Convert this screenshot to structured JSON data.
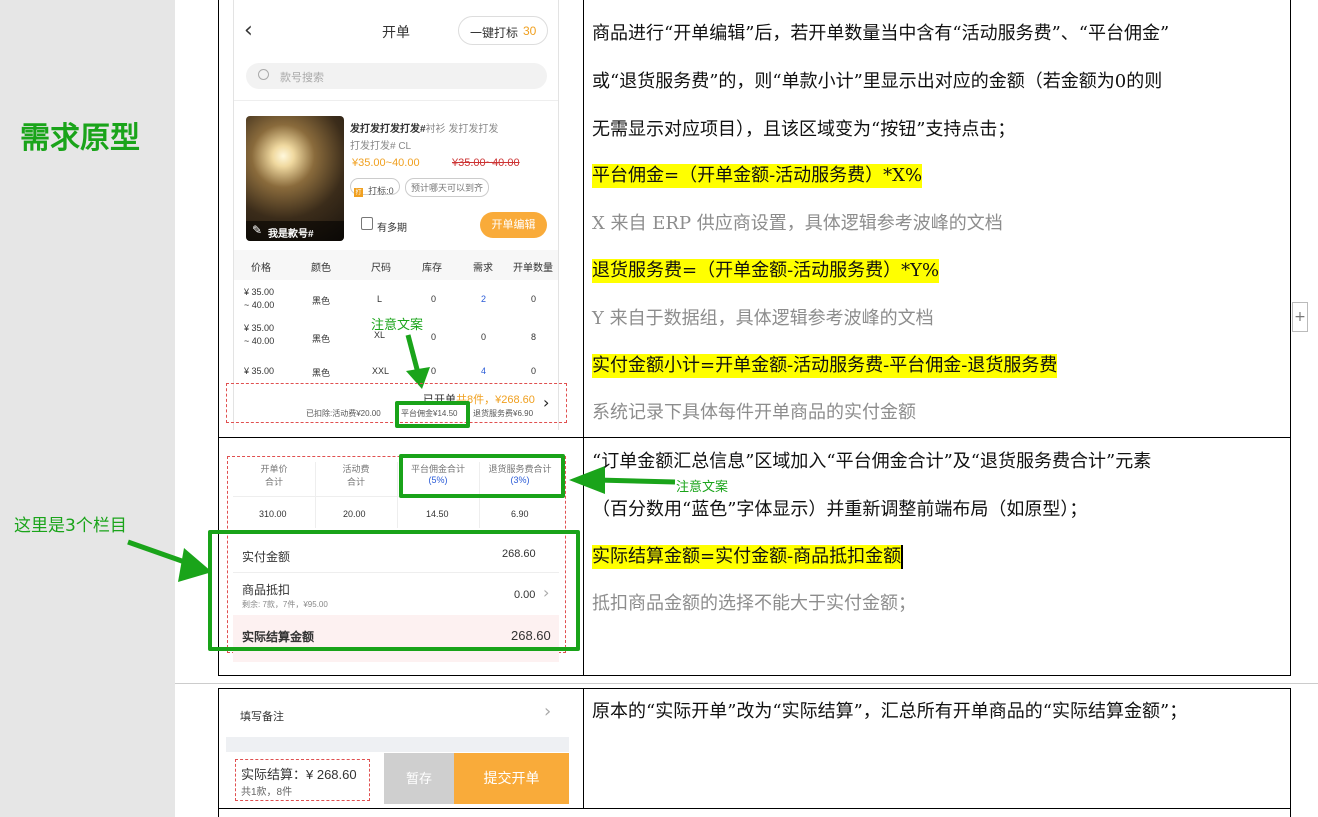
{
  "side_labels": {
    "prototype_heading": "需求原型",
    "three_columns_note": "这里是3个栏目"
  },
  "mock_top": {
    "nav_title": "开单",
    "quick_mark_label": "一键打标",
    "quick_mark_count": "30",
    "search_placeholder": "款号搜索",
    "product_title": "发打发打发打发#",
    "product_subtitle_a": "衬衫 发打发打发",
    "product_subtitle_b": "打发打发#  CL",
    "price_range": "¥35.00~40.00",
    "old_price_range": "¥35.00~40.00",
    "mark_tag": "打标:0",
    "preorder_tag": "预计哪天可以到齐",
    "image_caption": "我是款号#",
    "multi_period": "有多期",
    "edit_button": "开单编辑",
    "table_headers": [
      "价格",
      "颜色",
      "尺码",
      "库存",
      "需求",
      "开单数量"
    ],
    "rows": [
      {
        "price": "¥ 35.00\n~ 40.00",
        "color": "黑色",
        "size": "L",
        "stock": "0",
        "demand": "2",
        "qty": "0"
      },
      {
        "price": "¥ 35.00\n~ 40.00",
        "color": "黑色",
        "size": "XL",
        "stock": "0",
        "demand": "0",
        "qty": "8"
      },
      {
        "price": "¥ 35.00",
        "color": "黑色",
        "size": "XXL",
        "stock": "0",
        "demand": "4",
        "qty": "0"
      }
    ],
    "summary_prefix": "已开单",
    "summary_count": "共8件，",
    "summary_amount": "¥268.60",
    "deduction_activity": "已扣除:活动费¥20.00",
    "deduction_commission": "平台佣金¥14.50",
    "deduction_return": "退货服务费¥6.90",
    "attention_note": "注意文案"
  },
  "mock_middle": {
    "headers": [
      {
        "line1": "开单价",
        "line2": "合计"
      },
      {
        "line1": "活动费",
        "line2": "合计"
      },
      {
        "line1": "平台佣金合计",
        "line2": "(5%)"
      },
      {
        "line1": "退货服务费合计",
        "line2": "(3%)"
      }
    ],
    "values": [
      "310.00",
      "20.00",
      "14.50",
      "6.90"
    ],
    "actual_label": "实付金额",
    "actual_value": "268.60",
    "deduct_label": "商品抵扣",
    "deduct_sub": "剩余: 7款，7件，¥95.00",
    "deduct_value": "0.00",
    "settle_label": "实际结算金额",
    "settle_value": "268.60",
    "attention_note": "注意文案"
  },
  "mock_bottom": {
    "remark_label": "填写备注",
    "settle_text": "实际结算：¥ 268.60",
    "settle_sub": "共1款，8件",
    "hold_button": "暂存",
    "submit_button": "提交开单"
  },
  "right_col": {
    "row1": [
      "商品进行“开单编辑”后，若开单数量当中含有“活动服务费”、“平台佣金”",
      "或“退货服务费”的，则“单款小计”里显示出对应的金额（若金额为0的则",
      "无需显示对应项目），且该区域变为“按钮”支持点击；",
      "平台佣金=（开单金额-活动服务费）*X%",
      "X 来自 ERP 供应商设置，具体逻辑参考波峰的文档",
      "退货服务费=（开单金额-活动服务费）*Y%",
      "Y 来自于数据组，具体逻辑参考波峰的文档",
      "实付金额小计=开单金额-活动服务费-平台佣金-退货服务费",
      "系统记录下具体每件开单商品的实付金额"
    ],
    "row2": [
      "“订单金额汇总信息”区域加入“平台佣金合计”及“退货服务费合计”元素",
      "（百分数用“蓝色”字体显示）并重新调整前端布局（如原型）；",
      "实际结算金额=实付金额-商品抵扣金额",
      "抵扣商品金额的选择不能大于实付金额；"
    ],
    "row3": [
      "原本的“实际开单”改为“实际结算”，汇总所有开单商品的“实际结算金额”；"
    ]
  },
  "colors": {
    "highlight": "#ffff00",
    "annotation_green": "#1aa41a",
    "orange": "#f9ab3a",
    "blue_percent": "#2a5bd7",
    "dashed_red": "#e05050"
  },
  "icons": [
    "back-chevron-icon",
    "search-icon",
    "edit-icon",
    "calendar-icon",
    "chevron-right-icon",
    "plus-icon"
  ]
}
